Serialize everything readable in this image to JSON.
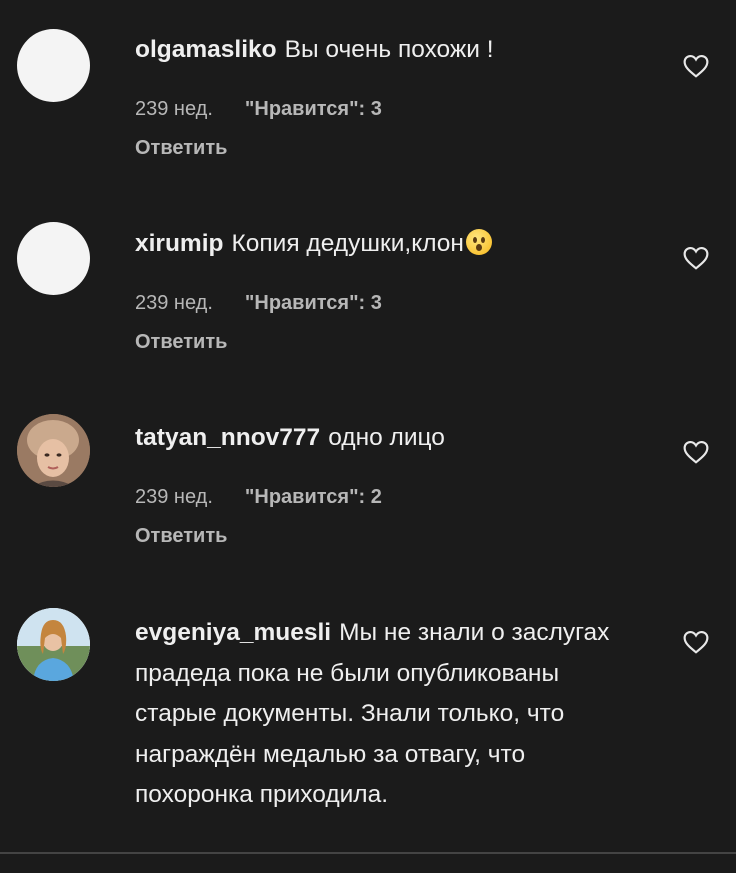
{
  "comments": [
    {
      "username": "olgamasliko",
      "text": "Вы очень похожи !",
      "time": "239 нед.",
      "likes": "\"Нравится\": 3",
      "reply": "Ответить",
      "avatar": "blank-avatar"
    },
    {
      "username": "xirumip",
      "text": "Копия дедушки,клон",
      "emoji": "hushed-face-emoji",
      "time": "239 нед.",
      "likes": "\"Нравится\": 3",
      "reply": "Ответить",
      "avatar": "blank-avatar"
    },
    {
      "username": "tatyan_nnov777",
      "text": "одно лицо",
      "time": "239 нед.",
      "likes": "\"Нравится\": 2",
      "reply": "Ответить",
      "avatar": "woman-photo-avatar"
    },
    {
      "username": "evgeniya_muesli",
      "text": "Мы не знали о заслугах прадеда пока не были опубликованы старые документы. Знали только, что награждён медалью за отвагу, что похоронка приходила.",
      "avatar": "woman-photo-avatar"
    }
  ],
  "icons": {
    "like": "heart-outline-icon"
  },
  "colors": {
    "background": "#1b1b1b",
    "primary_text": "#efefef",
    "secondary_text": "#b7b7b7",
    "blank_avatar": "#f4f4f4"
  }
}
